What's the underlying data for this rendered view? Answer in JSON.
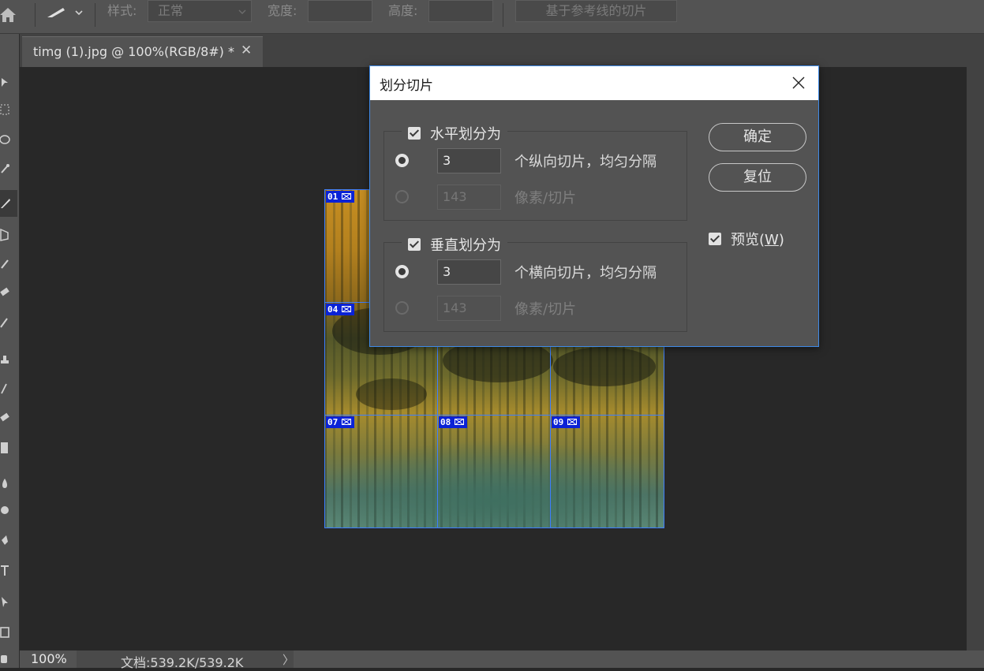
{
  "options_bar": {
    "style_label": "样式:",
    "style_value": "正常",
    "width_label": "宽度:",
    "width_value": "",
    "height_label": "高度:",
    "height_value": "",
    "guides_button": "基于参考线的切片"
  },
  "document": {
    "tab_title": "timg (1).jpg @ 100%(RGB/8#) *",
    "tab_close": "✕"
  },
  "slices": [
    "01",
    "04",
    "07",
    "08",
    "09"
  ],
  "status_bar": {
    "zoom": "100%",
    "doc_info": "文档:539.2K/539.2K",
    "arrow": "〉"
  },
  "dialog": {
    "title": "划分切片",
    "horizontal": {
      "label": "水平划分为",
      "checked": true,
      "count_value": "3",
      "count_label": "个纵向切片，均匀分隔",
      "pixels_value": "143",
      "pixels_label": "像素/切片"
    },
    "vertical": {
      "label": "垂直划分为",
      "checked": true,
      "count_value": "3",
      "count_label": "个横向切片，均匀分隔",
      "pixels_value": "143",
      "pixels_label": "像素/切片"
    },
    "ok_button": "确定",
    "reset_button": "复位",
    "preview_label": "预览(",
    "preview_key": "W",
    "preview_close": ")",
    "preview_checked": true
  },
  "colors": {
    "slice_line": "#3d7eff",
    "slice_badge": "#0a22d6",
    "dialog_border": "#3f8ae8"
  }
}
